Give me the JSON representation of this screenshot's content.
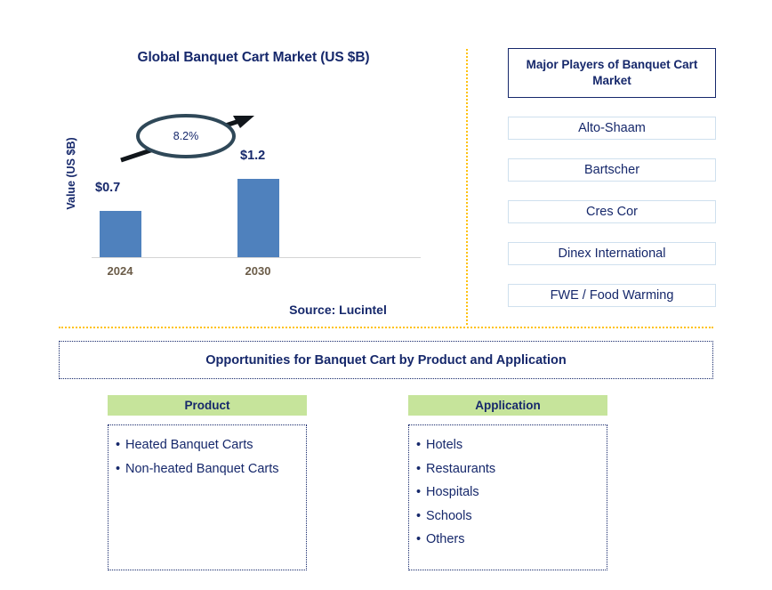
{
  "chart": {
    "title": "Global Banquet Cart Market (US $B)",
    "y_axis_title": "Value (US $B)",
    "cagr_label": "8.2%",
    "source": "Source: Lucintel",
    "bar_color": "#4F81BD",
    "text_color": "#16286B"
  },
  "chart_data": {
    "type": "bar",
    "title": "Global Banquet Cart Market (US $B)",
    "categories": [
      "2024",
      "2030"
    ],
    "values": [
      0.7,
      1.2
    ],
    "value_labels": [
      "$0.7",
      "$1.2"
    ],
    "xlabel": "",
    "ylabel": "Value (US $B)",
    "ylim": [
      0,
      1.4
    ],
    "grid": false,
    "legend": "none",
    "annotations": [
      {
        "text": "8.2%",
        "type": "cagr-ellipse-with-arrow",
        "from": "2024",
        "to": "2030"
      }
    ],
    "source": "Source: Lucintel"
  },
  "players": {
    "header": "Major Players of Banquet Cart Market",
    "items": [
      "Alto-Shaam",
      "Bartscher",
      "Cres Cor",
      "Dinex International",
      "FWE / Food Warming"
    ]
  },
  "opportunities": {
    "banner": "Opportunities for Banquet Cart by Product and Application",
    "bullet": "•",
    "columns": [
      {
        "header": "Product",
        "items": [
          "Heated Banquet Carts",
          "Non-heated Banquet Carts"
        ]
      },
      {
        "header": "Application",
        "items": [
          "Hotels",
          "Restaurants",
          "Hospitals",
          "Schools",
          "Others"
        ]
      }
    ]
  },
  "colors": {
    "navy": "#16286B",
    "bar_blue": "#4F81BD",
    "divider_gold": "#FFC20E",
    "header_green": "#C6E49B",
    "player_border": "#CFE0EE",
    "axis_label_brown": "#6B5C48"
  }
}
